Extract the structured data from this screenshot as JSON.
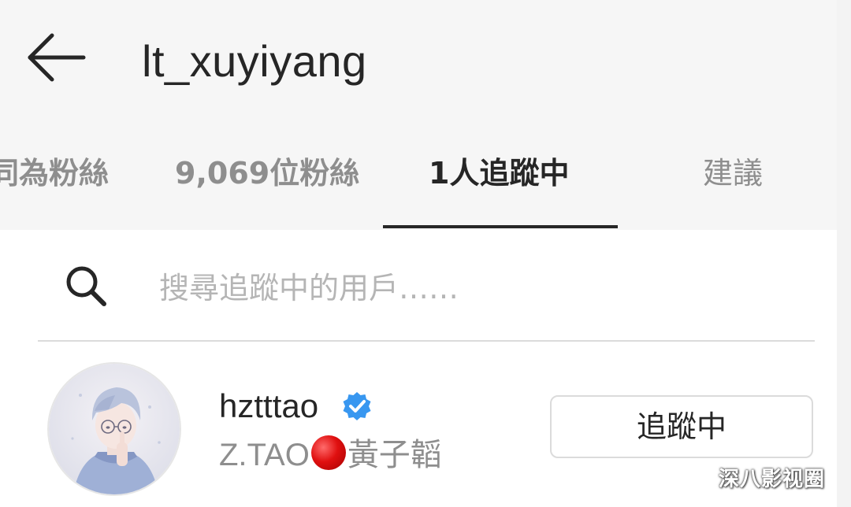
{
  "header": {
    "back_icon": "arrow-left-icon",
    "title": "lt_xuyiyang"
  },
  "tabs": [
    {
      "label": "同為粉絲",
      "active": false
    },
    {
      "label": "9,069位粉絲",
      "active": false
    },
    {
      "label": "1人追蹤中",
      "active": true
    },
    {
      "label": "建議",
      "active": false
    }
  ],
  "search": {
    "icon": "search-icon",
    "placeholder": "搜尋追蹤中的用戶……"
  },
  "following_list": [
    {
      "username": "hztttao",
      "verified": true,
      "full_name_prefix": "Z.TAO",
      "full_name_emoji": "red-circle",
      "full_name_suffix": "黃子韜",
      "button_label": "追蹤中"
    }
  ],
  "watermark": "深八影视圈",
  "colors": {
    "header_bg": "#f6f6f6",
    "text_primary": "#262626",
    "text_muted": "#8e8e8e",
    "verified_blue": "#3897f0",
    "divider": "#dbdbdb"
  }
}
